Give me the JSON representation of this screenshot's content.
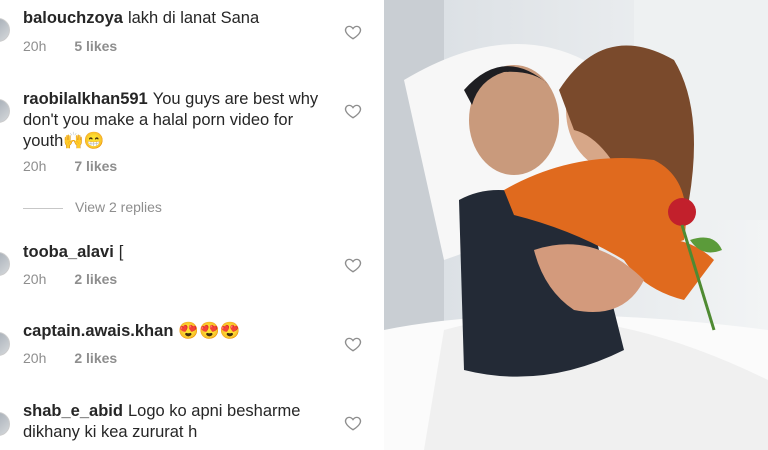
{
  "comments": [
    {
      "username": "balouchzoya",
      "text": "lakh di lanat Sana",
      "emoji": "",
      "time": "20h",
      "likes": "5 likes"
    },
    {
      "username": "raobilalkhan591",
      "text": "You guys are best why don't you make a halal porn video for youth",
      "emoji": "🙌😁",
      "time": "20h",
      "likes": "7 likes"
    },
    {
      "username": "tooba_alavi",
      "text": "[",
      "emoji": "",
      "time": "20h",
      "likes": "2 likes"
    },
    {
      "username": "captain.awais.khan",
      "text": "",
      "emoji": "😍😍😍",
      "time": "20h",
      "likes": "2 likes"
    },
    {
      "username": "shab_e_abid",
      "text": "Logo ko apni besharme dikhany ki kea zururat h",
      "emoji": "",
      "time": "",
      "likes": ""
    }
  ],
  "view_replies": "View 2 replies",
  "icons": {
    "like": "heart-outline-icon"
  },
  "colors": {
    "text": "#262626",
    "secondary": "#8e8e8e"
  }
}
